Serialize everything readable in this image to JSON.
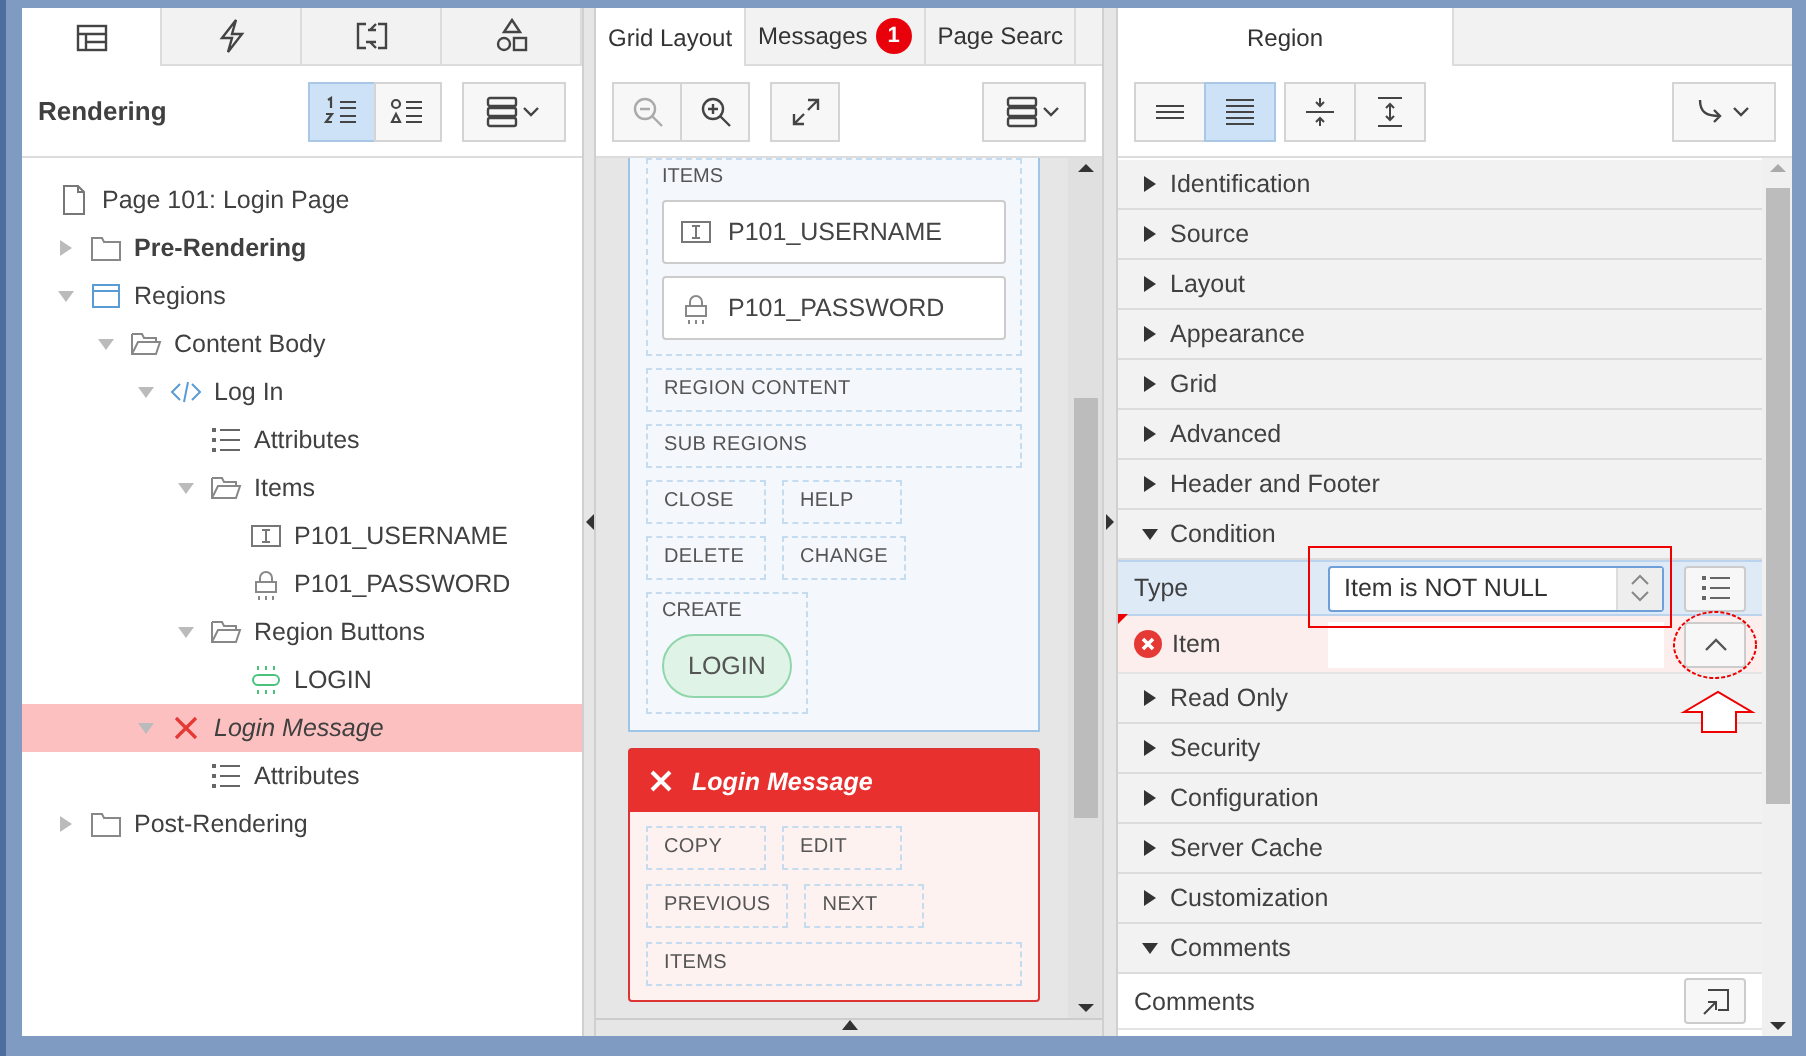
{
  "left_panel": {
    "tabs": [
      {
        "kind": "tree",
        "selected": true
      },
      {
        "kind": "bolt",
        "selected": false
      },
      {
        "kind": "exchange",
        "selected": false
      },
      {
        "kind": "shapes",
        "selected": false
      }
    ],
    "title": "Rendering",
    "view_toggles": [
      {
        "kind": "ordered",
        "selected": true
      },
      {
        "kind": "grouped",
        "selected": false
      }
    ],
    "tree": [
      {
        "kind": "page",
        "label": "Page 101: Login Page",
        "selected": false
      },
      {
        "kind": "folder",
        "label": "Pre-Rendering",
        "bold": true,
        "expanded": false,
        "selected": false
      },
      {
        "kind": "region",
        "label": "Regions",
        "expanded": true,
        "selected": false,
        "children": [
          {
            "kind": "open-folder",
            "label": "Content Body",
            "expanded": true,
            "selected": false,
            "children": [
              {
                "kind": "code",
                "label": "Log In",
                "expanded": true,
                "selected": false,
                "children": [
                  {
                    "kind": "attributes",
                    "label": "Attributes",
                    "selected": false
                  },
                  {
                    "kind": "open-folder",
                    "label": "Items",
                    "expanded": true,
                    "selected": false,
                    "children": [
                      {
                        "kind": "text-item",
                        "label": "P101_USERNAME",
                        "selected": false
                      },
                      {
                        "kind": "password-item",
                        "label": "P101_PASSWORD",
                        "selected": false
                      }
                    ]
                  },
                  {
                    "kind": "open-folder",
                    "label": "Region Buttons",
                    "expanded": true,
                    "selected": false,
                    "children": [
                      {
                        "kind": "button",
                        "label": "LOGIN",
                        "selected": false
                      }
                    ]
                  }
                ]
              },
              {
                "kind": "error",
                "label": "Login Message",
                "expanded": true,
                "selected": true,
                "children": [
                  {
                    "kind": "attributes",
                    "label": "Attributes",
                    "selected": false
                  }
                ]
              }
            ]
          }
        ]
      },
      {
        "kind": "folder",
        "label": "Post-Rendering",
        "expanded": false,
        "selected": false
      }
    ]
  },
  "grid_panel": {
    "tabs": [
      {
        "label": "Grid Layout",
        "selected": true
      },
      {
        "label": "Messages",
        "badge": "1",
        "selected": false
      },
      {
        "label": "Page Searc",
        "selected": false
      }
    ],
    "regions": [
      {
        "kind": "normal",
        "items_label": "ITEMS",
        "items": [
          {
            "kind": "text",
            "label": "P101_USERNAME"
          },
          {
            "kind": "password",
            "label": "P101_PASSWORD"
          }
        ],
        "slot_rows": [
          [
            "REGION CONTENT"
          ],
          [
            "SUB REGIONS"
          ],
          [
            "CLOSE",
            "HELP"
          ],
          [
            "DELETE",
            "CHANGE"
          ]
        ],
        "create": {
          "label": "CREATE",
          "button": "LOGIN"
        }
      },
      {
        "kind": "error",
        "title": "Login Message",
        "slot_rows": [
          [
            "COPY",
            "EDIT"
          ],
          [
            "PREVIOUS",
            "NEXT"
          ],
          [
            "ITEMS"
          ]
        ]
      }
    ]
  },
  "property_panel": {
    "tabs": [
      {
        "label": "Region",
        "selected": true
      }
    ],
    "view_toggles": [
      {
        "kind": "common",
        "selected": false
      },
      {
        "kind": "all",
        "selected": true
      }
    ],
    "rows": [
      {
        "kind": "group",
        "label": "Identification",
        "expanded": false
      },
      {
        "kind": "group",
        "label": "Source",
        "expanded": false
      },
      {
        "kind": "group",
        "label": "Layout",
        "expanded": false
      },
      {
        "kind": "group",
        "label": "Appearance",
        "expanded": false
      },
      {
        "kind": "group",
        "label": "Grid",
        "expanded": false
      },
      {
        "kind": "group",
        "label": "Advanced",
        "expanded": false
      },
      {
        "kind": "group",
        "label": "Header and Footer",
        "expanded": false
      },
      {
        "kind": "group",
        "label": "Condition",
        "expanded": true
      },
      {
        "kind": "select",
        "label": "Type",
        "value": "Item is NOT NULL",
        "selected": true,
        "error": false
      },
      {
        "kind": "text",
        "label": "Item",
        "selected": false,
        "error": true
      },
      {
        "kind": "group",
        "label": "Read Only",
        "expanded": false
      },
      {
        "kind": "group",
        "label": "Security",
        "expanded": false
      },
      {
        "kind": "group",
        "label": "Configuration",
        "expanded": false
      },
      {
        "kind": "group",
        "label": "Server Cache",
        "expanded": false
      },
      {
        "kind": "group",
        "label": "Customization",
        "expanded": false
      },
      {
        "kind": "group",
        "label": "Comments",
        "expanded": true
      },
      {
        "kind": "textarea",
        "label": "Comments",
        "selected": false,
        "error": false
      }
    ]
  }
}
